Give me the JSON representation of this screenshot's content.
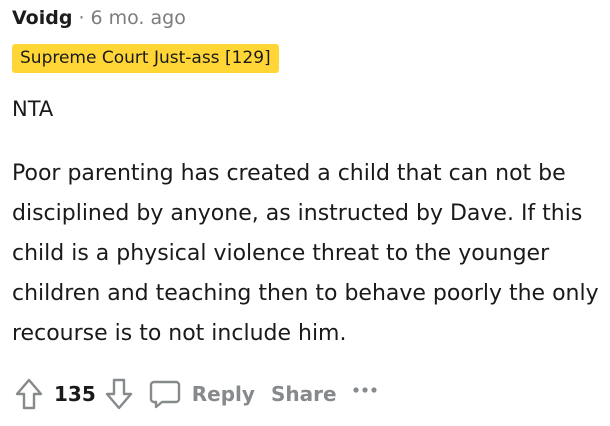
{
  "comment": {
    "author": "Voidg",
    "separator": "·",
    "age": "6 mo. ago",
    "flair": "Supreme Court Just-ass [129]",
    "paragraphs": [
      "NTA",
      "Poor parenting has created a child that can not be disciplined by anyone, as instructed by Dave. If this child is a physical violence threat to the younger children and teaching then to behave poorly the only recourse is to not include him."
    ]
  },
  "actions": {
    "score": "135",
    "reply_label": "Reply",
    "share_label": "Share",
    "upvote_icon": "upvote-arrow",
    "downvote_icon": "downvote-arrow",
    "reply_icon": "speech-bubble",
    "more_icon": "ellipsis"
  },
  "colors": {
    "flair_bg": "#ffd635",
    "muted": "#878a8c",
    "text": "#1a1a1b"
  }
}
